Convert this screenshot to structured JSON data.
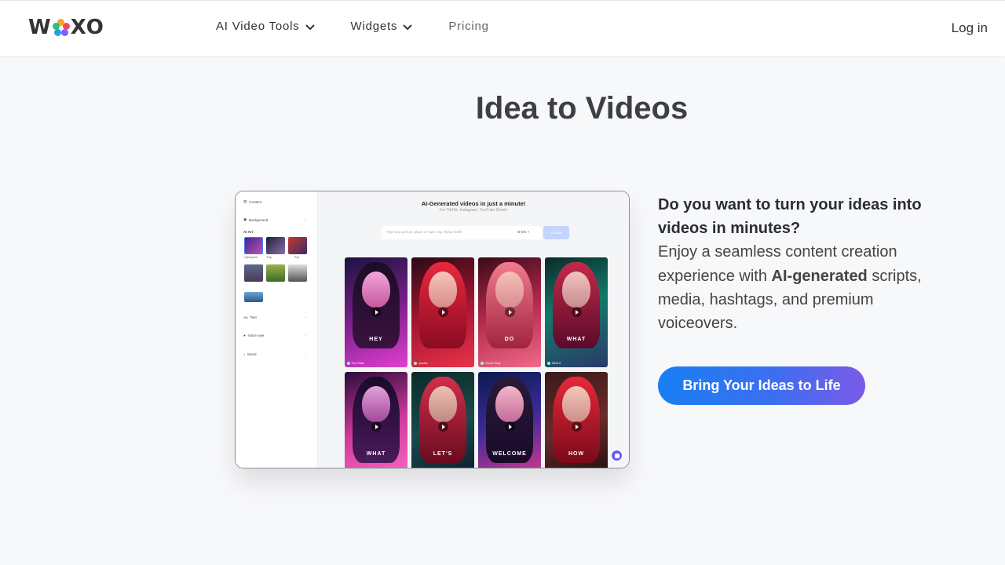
{
  "header": {
    "logo_left": "W",
    "logo_right": "XO",
    "nav": [
      {
        "label": "AI Video Tools",
        "has_dropdown": true
      },
      {
        "label": "Widgets",
        "has_dropdown": true
      },
      {
        "label": "Pricing",
        "has_dropdown": false
      }
    ],
    "login": "Log in"
  },
  "hero": {
    "title": "Idea to Videos"
  },
  "preview": {
    "sidebar": {
      "content": "Content",
      "background": "Background",
      "ai_art": "AI Art",
      "thumb_captions": [
        "Cyberpunk",
        "Pop",
        "Pop",
        "",
        "",
        ""
      ],
      "text": "Text",
      "voiceover": "Voice over",
      "music": "Music"
    },
    "title": "AI-Generated videos in just a minute!",
    "subtitle": "For TikTok, Instagram, YouTube Shorts",
    "input_placeholder": "Type any person, place or topic. Eg. Taylor Swift",
    "lang": "EN",
    "button": "Create",
    "tiles": [
      {
        "word": "HEY",
        "label": "Fun Facts"
      },
      {
        "word": "",
        "label": "Quotes"
      },
      {
        "word": "DO",
        "label": "Horror Story"
      },
      {
        "word": "WHAT",
        "label": "What if"
      },
      {
        "word": "WHAT",
        "label": ""
      },
      {
        "word": "LET'S",
        "label": ""
      },
      {
        "word": "WELCOME",
        "label": ""
      },
      {
        "word": "HOW",
        "label": ""
      }
    ]
  },
  "pitch": {
    "question": "Do you want to turn your ideas into videos in minutes?",
    "body_1": "Enjoy a seamless content creation experience with ",
    "body_bold": "AI-generated",
    "body_2": " scripts, media, hashtags, and premium voiceovers."
  },
  "cta": {
    "label": "Bring Your Ideas to Life"
  },
  "colors": {
    "cta_start": "#1a7ff4",
    "cta_end": "#7a5ae7",
    "background": "#f7f8fa"
  }
}
